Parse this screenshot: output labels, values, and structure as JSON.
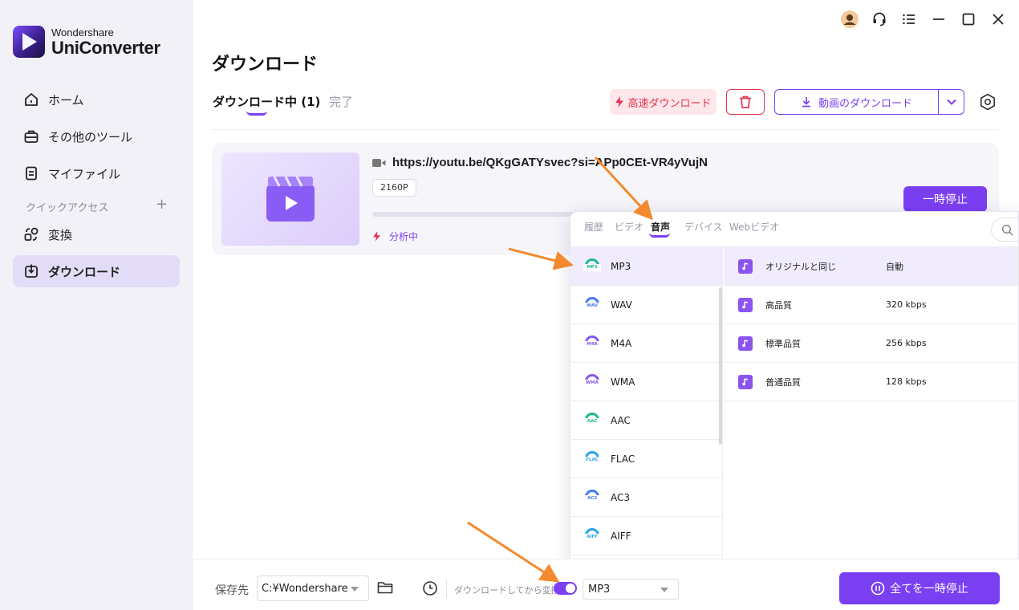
{
  "brand": {
    "line1": "Wondershare",
    "line2": "UniConverter"
  },
  "sidebar": {
    "items": [
      {
        "label": "ホーム"
      },
      {
        "label": "その他のツール"
      },
      {
        "label": "マイファイル"
      },
      {
        "label": "変換"
      },
      {
        "label": "ダウンロード"
      }
    ],
    "quick_access_label": "クイックアクセス",
    "quick_access_add": "+"
  },
  "page": {
    "title": "ダウンロード"
  },
  "tabs": {
    "downloading": "ダウンロード中 (1)",
    "done": "完了"
  },
  "toolbar": {
    "fast_download": "高速ダウンロード",
    "video_download": "動画のダウンロード"
  },
  "item": {
    "url": "https://youtu.be/QKgGATYsvec?si=APp0CEt-VR4yVujN",
    "resolution": "2160P",
    "status": "分析中",
    "pause_label": "一時停止"
  },
  "popup": {
    "tabs": [
      "履歴",
      "ビデオ",
      "音声",
      "デバイス",
      "Webビデオ"
    ],
    "active_tab": "音声",
    "formats": [
      {
        "label": "MP3",
        "tag": "MP3",
        "color": "#1fb98a"
      },
      {
        "label": "WAV",
        "tag": "WAV",
        "color": "#3f7df2"
      },
      {
        "label": "M4A",
        "tag": "M4A",
        "color": "#8b54f0"
      },
      {
        "label": "WMA",
        "tag": "WMA",
        "color": "#8b54f0"
      },
      {
        "label": "AAC",
        "tag": "AAC",
        "color": "#1fb98a"
      },
      {
        "label": "FLAC",
        "tag": "FLAC",
        "color": "#2aa3e8"
      },
      {
        "label": "AC3",
        "tag": "AC3",
        "color": "#3f7df2"
      },
      {
        "label": "AIFF",
        "tag": "AIFF",
        "color": "#2aa3e8"
      }
    ],
    "qualities": [
      {
        "name": "オリジナルと同じ",
        "value": "自動"
      },
      {
        "name": "高品質",
        "value": "320 kbps"
      },
      {
        "name": "標準品質",
        "value": "256 kbps"
      },
      {
        "name": "普通品質",
        "value": "128 kbps"
      }
    ]
  },
  "bottom": {
    "save_label": "保存先",
    "save_path": "C:¥Wondershare",
    "convert_label": "ダウンロードしてから変換:",
    "convert_enabled": true,
    "format": "MP3",
    "pause_all": "全てを一時停止"
  },
  "colors": {
    "accent": "#7b3ff2",
    "danger": "#e5344f",
    "annotation": "#f5892e"
  }
}
